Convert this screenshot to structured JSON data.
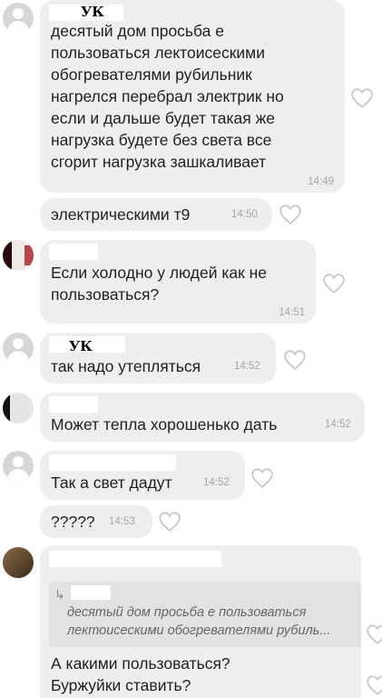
{
  "messages": [
    {
      "sender": "УК",
      "text": "десятый  дом просьба е\nпользоваться  лектоисескими\nобогревателями  рубильник\nнагрелся  перебрал электрик но\nесли и дальше будет такая же\nнагрузка будете без света все\nсгорит  нагрузка зашкаливает",
      "time": "14:49"
    },
    {
      "text": "электрическими т9",
      "time": "14:50"
    },
    {
      "text": "Если холодно у людей как не\nпользоваться?",
      "time": "14:51"
    },
    {
      "sender": "УК",
      "text": "так надо утепляться",
      "time": "14:52"
    },
    {
      "text": "Может тепла хорошенько дать",
      "time": "14:52"
    },
    {
      "text": "Так а свет дадут",
      "time": "14:52"
    },
    {
      "text": "?????",
      "time": "14:53"
    },
    {
      "reply_quote": {
        "arrow": "↳",
        "line1": "десятый  дом просьба е пользоваться",
        "line2": "лектоисескими обогревателями  рубиль..."
      },
      "text": "А какими пользоваться?\nБуржуйки ставить?"
    }
  ]
}
